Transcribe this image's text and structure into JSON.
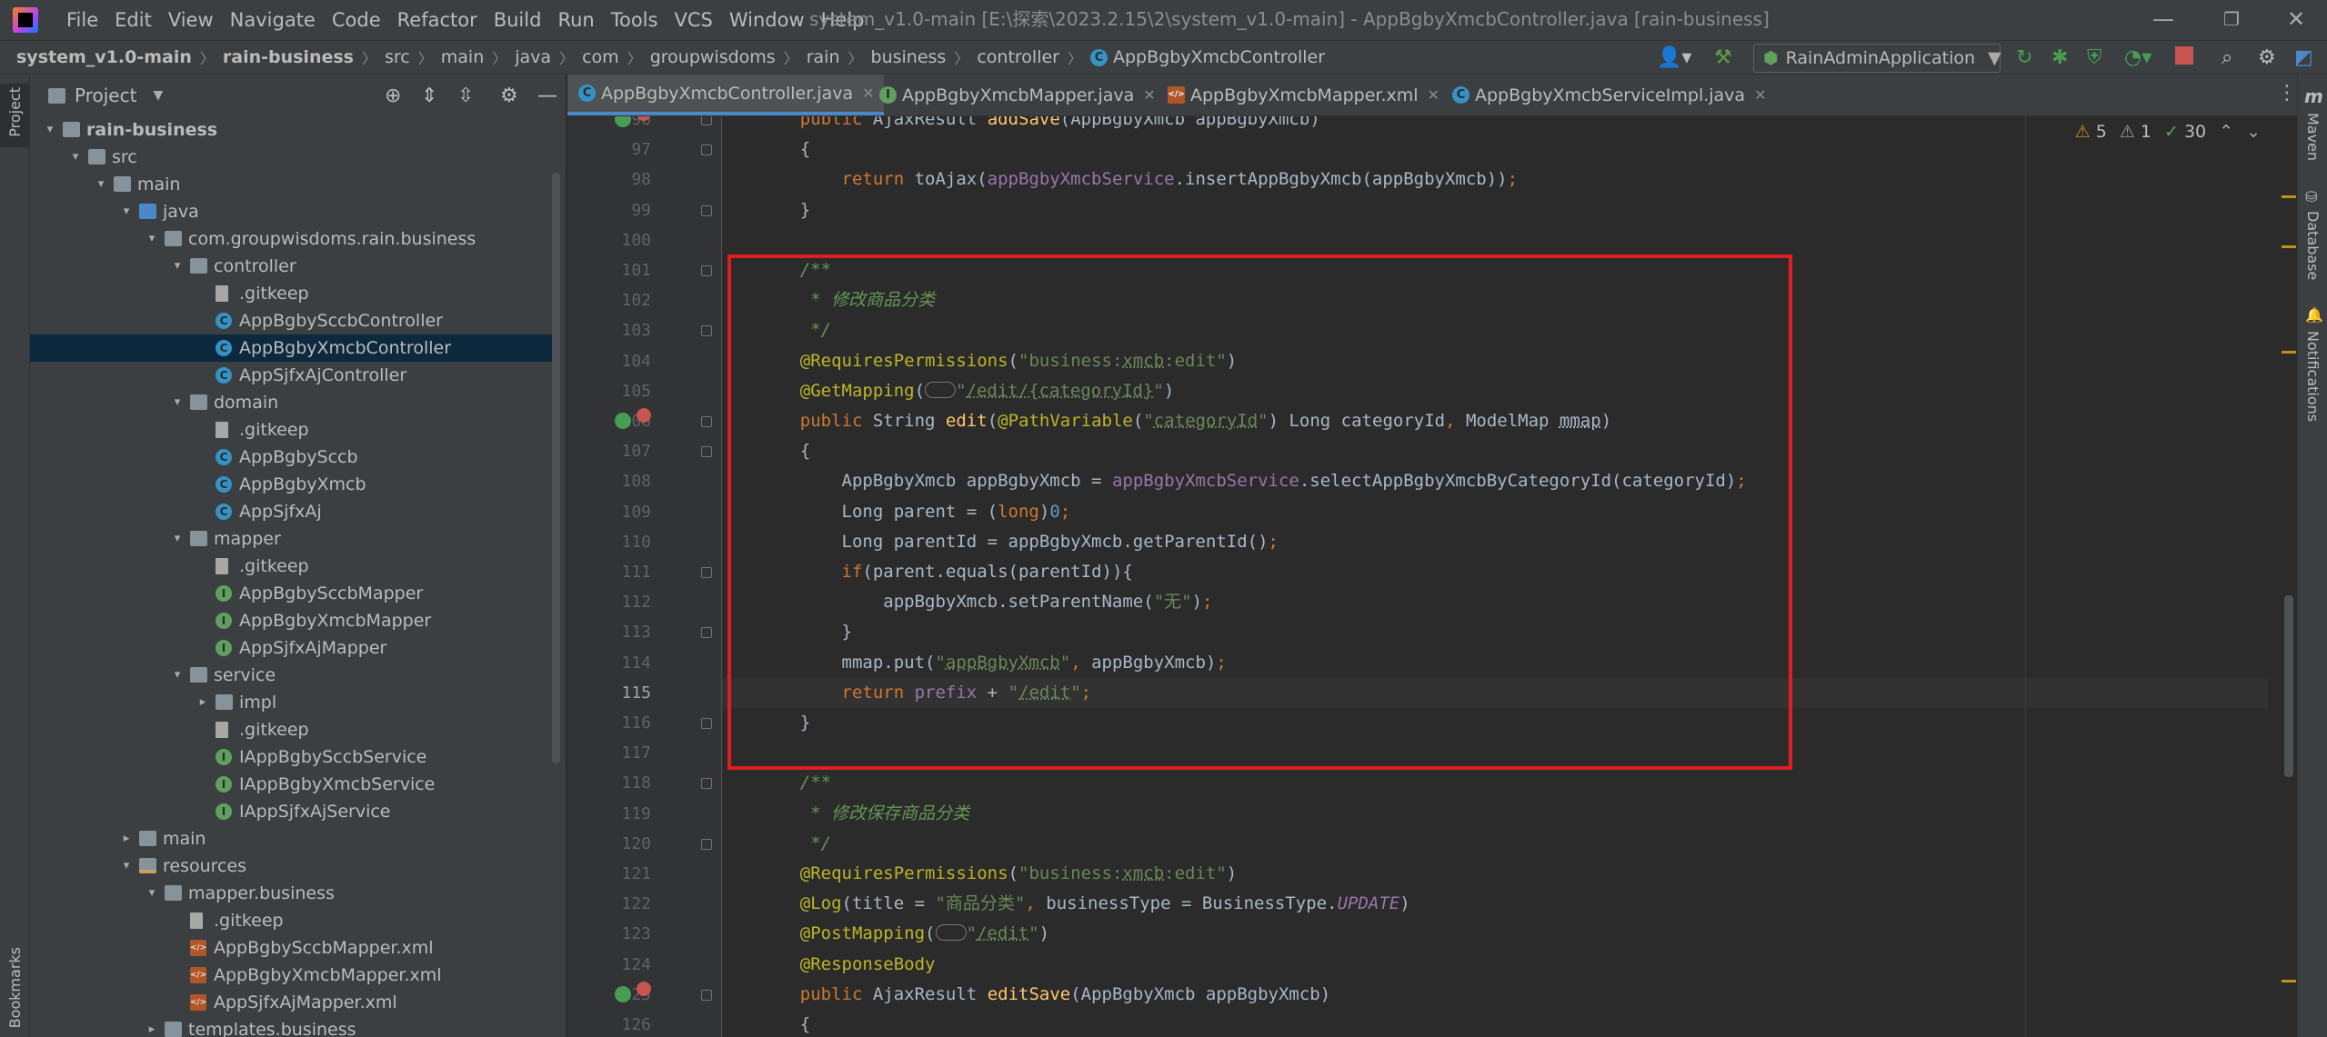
{
  "window": {
    "title": "system_v1.0-main [E:\\探索\\2023.2.15\\2\\system_v1.0-main] - AppBgbyXmcbController.java [rain-business]",
    "controls": [
      "—",
      "❐",
      "✕"
    ]
  },
  "menu": [
    "File",
    "Edit",
    "View",
    "Navigate",
    "Code",
    "Refactor",
    "Build",
    "Run",
    "Tools",
    "VCS",
    "Window",
    "Help"
  ],
  "breadcrumb": [
    "system_v1.0-main",
    "rain-business",
    "src",
    "main",
    "java",
    "com",
    "groupwisdoms",
    "rain",
    "business",
    "controller",
    "AppBgbyXmcbController"
  ],
  "run_config": {
    "label": "RainAdminApplication"
  },
  "sidebars": {
    "left_top": "Project",
    "left_bottom": "Bookmarks",
    "right": [
      "Maven",
      "Database",
      "Notifications"
    ]
  },
  "project_panel": {
    "title": "Project",
    "tree": [
      {
        "label": "rain-business",
        "depth": 0,
        "arrow": "▾",
        "icon": "folder",
        "bold": true
      },
      {
        "label": "src",
        "depth": 1,
        "arrow": "▾",
        "icon": "folder"
      },
      {
        "label": "main",
        "depth": 2,
        "arrow": "▾",
        "icon": "folder"
      },
      {
        "label": "java",
        "depth": 3,
        "arrow": "▾",
        "icon": "folder-blue"
      },
      {
        "label": "com.groupwisdoms.rain.business",
        "depth": 4,
        "arrow": "▾",
        "icon": "folder"
      },
      {
        "label": "controller",
        "depth": 5,
        "arrow": "▾",
        "icon": "folder"
      },
      {
        "label": ".gitkeep",
        "depth": 6,
        "arrow": "",
        "icon": "file"
      },
      {
        "label": "AppBgbySccbController",
        "depth": 6,
        "arrow": "",
        "icon": "class"
      },
      {
        "label": "AppBgbyXmcbController",
        "depth": 6,
        "arrow": "",
        "icon": "class",
        "selected": true
      },
      {
        "label": "AppSjfxAjController",
        "depth": 6,
        "arrow": "",
        "icon": "class"
      },
      {
        "label": "domain",
        "depth": 5,
        "arrow": "▾",
        "icon": "folder"
      },
      {
        "label": ".gitkeep",
        "depth": 6,
        "arrow": "",
        "icon": "file"
      },
      {
        "label": "AppBgbySccb",
        "depth": 6,
        "arrow": "",
        "icon": "class"
      },
      {
        "label": "AppBgbyXmcb",
        "depth": 6,
        "arrow": "",
        "icon": "class"
      },
      {
        "label": "AppSjfxAj",
        "depth": 6,
        "arrow": "",
        "icon": "class"
      },
      {
        "label": "mapper",
        "depth": 5,
        "arrow": "▾",
        "icon": "folder"
      },
      {
        "label": ".gitkeep",
        "depth": 6,
        "arrow": "",
        "icon": "file"
      },
      {
        "label": "AppBgbySccbMapper",
        "depth": 6,
        "arrow": "",
        "icon": "interface"
      },
      {
        "label": "AppBgbyXmcbMapper",
        "depth": 6,
        "arrow": "",
        "icon": "interface"
      },
      {
        "label": "AppSjfxAjMapper",
        "depth": 6,
        "arrow": "",
        "icon": "interface"
      },
      {
        "label": "service",
        "depth": 5,
        "arrow": "▾",
        "icon": "folder"
      },
      {
        "label": "impl",
        "depth": 6,
        "arrow": "▸",
        "icon": "folder"
      },
      {
        "label": ".gitkeep",
        "depth": 6,
        "arrow": "",
        "icon": "file"
      },
      {
        "label": "IAppBgbySccbService",
        "depth": 6,
        "arrow": "",
        "icon": "interface"
      },
      {
        "label": "IAppBgbyXmcbService",
        "depth": 6,
        "arrow": "",
        "icon": "interface"
      },
      {
        "label": "IAppSjfxAjService",
        "depth": 6,
        "arrow": "",
        "icon": "interface"
      },
      {
        "label": "main",
        "depth": 3,
        "arrow": "▸",
        "icon": "folder"
      },
      {
        "label": "resources",
        "depth": 3,
        "arrow": "▾",
        "icon": "folder-res"
      },
      {
        "label": "mapper.business",
        "depth": 4,
        "arrow": "▾",
        "icon": "folder"
      },
      {
        "label": ".gitkeep",
        "depth": 5,
        "arrow": "",
        "icon": "file"
      },
      {
        "label": "AppBgbySccbMapper.xml",
        "depth": 5,
        "arrow": "",
        "icon": "xml"
      },
      {
        "label": "AppBgbyXmcbMapper.xml",
        "depth": 5,
        "arrow": "",
        "icon": "xml"
      },
      {
        "label": "AppSjfxAjMapper.xml",
        "depth": 5,
        "arrow": "",
        "icon": "xml"
      },
      {
        "label": "templates.business",
        "depth": 4,
        "arrow": "▸",
        "icon": "folder"
      }
    ]
  },
  "tabs": [
    {
      "label": "AppBgbyXmcbController.java",
      "icon": "class",
      "active": true
    },
    {
      "label": "AppBgbyXmcbMapper.java",
      "icon": "interface"
    },
    {
      "label": "AppBgbyXmcbMapper.xml",
      "icon": "xml"
    },
    {
      "label": "AppBgbyXmcbServiceImpl.java",
      "icon": "class"
    }
  ],
  "inspections": {
    "warnings": "5",
    "weak_warnings": "1",
    "typos": "30"
  },
  "editor": {
    "current_line": "115",
    "lines": [
      {
        "n": "96",
        "tokens": [
          [
            "    ",
            ""
          ],
          [
            "public ",
            "kw"
          ],
          [
            "AjaxResult ",
            ""
          ],
          [
            "addSave",
            "fn"
          ],
          [
            "(AppBgbyXmcb appBgbyXmcb)",
            ""
          ]
        ]
      },
      {
        "n": "97",
        "tokens": [
          [
            "    {",
            ""
          ]
        ]
      },
      {
        "n": "98",
        "tokens": [
          [
            "        ",
            ""
          ],
          [
            "return ",
            "kw"
          ],
          [
            "toAjax(",
            ""
          ],
          [
            "appBgbyXmcbService",
            "field"
          ],
          [
            ".insertAppBgbyXmcb(appBgbyXmcb))",
            ""
          ],
          [
            ";",
            "kw"
          ]
        ]
      },
      {
        "n": "99",
        "tokens": [
          [
            "    }",
            ""
          ]
        ]
      },
      {
        "n": "100",
        "tokens": []
      },
      {
        "n": "101",
        "tokens": [
          [
            "    /**",
            "doc"
          ]
        ]
      },
      {
        "n": "102",
        "tokens": [
          [
            "     * 修改商品分类",
            "doc"
          ]
        ]
      },
      {
        "n": "103",
        "tokens": [
          [
            "     */",
            "doc"
          ]
        ]
      },
      {
        "n": "104",
        "tokens": [
          [
            "    ",
            ""
          ],
          [
            "@RequiresPermissions",
            "ann"
          ],
          [
            "(",
            ""
          ],
          [
            "\"business:",
            "str"
          ],
          [
            "xmcb",
            "str ul"
          ],
          [
            ":edit\"",
            "str"
          ],
          [
            ")",
            ""
          ]
        ]
      },
      {
        "n": "105",
        "tokens": [
          [
            "    ",
            ""
          ],
          [
            "@GetMapping",
            "ann"
          ],
          [
            "(",
            ""
          ],
          [
            "ICON",
            ""
          ],
          [
            "\"",
            "str"
          ],
          [
            "/edit/{categoryId}",
            "str ul"
          ],
          [
            "\"",
            "str"
          ],
          [
            ")",
            ""
          ]
        ]
      },
      {
        "n": "106",
        "tokens": [
          [
            "    ",
            ""
          ],
          [
            "public ",
            "kw"
          ],
          [
            "String ",
            ""
          ],
          [
            "edit",
            "fn"
          ],
          [
            "(",
            ""
          ],
          [
            "@PathVariable",
            "ann"
          ],
          [
            "(",
            ""
          ],
          [
            "\"",
            "str"
          ],
          [
            "categoryId",
            "str ul"
          ],
          [
            "\"",
            "str"
          ],
          [
            ") Long categoryId",
            ""
          ],
          [
            ", ",
            "kw"
          ],
          [
            "ModelMap ",
            ""
          ],
          [
            "mmap",
            "ul"
          ],
          [
            ")",
            ""
          ]
        ]
      },
      {
        "n": "107",
        "tokens": [
          [
            "    {",
            ""
          ]
        ]
      },
      {
        "n": "108",
        "tokens": [
          [
            "        AppBgbyXmcb appBgbyXmcb = ",
            ""
          ],
          [
            "appBgbyXmcbService",
            "field"
          ],
          [
            ".selectAppBgbyXmcbByCategoryId(categoryId)",
            ""
          ],
          [
            ";",
            "kw"
          ]
        ]
      },
      {
        "n": "109",
        "tokens": [
          [
            "        Long parent = (",
            ""
          ],
          [
            "long",
            "kw"
          ],
          [
            ")",
            ""
          ],
          [
            "0",
            "num"
          ],
          [
            ";",
            "kw"
          ]
        ]
      },
      {
        "n": "110",
        "tokens": [
          [
            "        Long parentId = appBgbyXmcb.getParentId()",
            ""
          ],
          [
            ";",
            "kw"
          ]
        ]
      },
      {
        "n": "111",
        "tokens": [
          [
            "        ",
            ""
          ],
          [
            "if",
            "kw"
          ],
          [
            "(parent.equals(parentId)){",
            ""
          ]
        ]
      },
      {
        "n": "112",
        "tokens": [
          [
            "            appBgbyXmcb.setParentName(",
            ""
          ],
          [
            "\"无\"",
            "str"
          ],
          [
            ")",
            ""
          ],
          [
            ";",
            "kw"
          ]
        ]
      },
      {
        "n": "113",
        "tokens": [
          [
            "        }",
            ""
          ]
        ]
      },
      {
        "n": "114",
        "tokens": [
          [
            "        mmap.put(",
            ""
          ],
          [
            "\"",
            "str"
          ],
          [
            "appBgbyXmcb",
            "str ul"
          ],
          [
            "\"",
            "str"
          ],
          [
            ", ",
            "kw"
          ],
          [
            "appBgbyXmcb)",
            ""
          ],
          [
            ";",
            "kw"
          ]
        ]
      },
      {
        "n": "115",
        "tokens": [
          [
            "        ",
            ""
          ],
          [
            "return ",
            "kw"
          ],
          [
            "prefix",
            "field"
          ],
          [
            " + ",
            ""
          ],
          [
            "\"",
            "str"
          ],
          [
            "/edit",
            "str ul"
          ],
          [
            "\"",
            "str"
          ],
          [
            ";",
            "kw"
          ]
        ]
      },
      {
        "n": "116",
        "tokens": [
          [
            "    }",
            ""
          ]
        ]
      },
      {
        "n": "117",
        "tokens": []
      },
      {
        "n": "118",
        "tokens": [
          [
            "    /**",
            "doc"
          ]
        ]
      },
      {
        "n": "119",
        "tokens": [
          [
            "     * 修改保存商品分类",
            "doc"
          ]
        ]
      },
      {
        "n": "120",
        "tokens": [
          [
            "     */",
            "doc"
          ]
        ]
      },
      {
        "n": "121",
        "tokens": [
          [
            "    ",
            ""
          ],
          [
            "@RequiresPermissions",
            "ann"
          ],
          [
            "(",
            ""
          ],
          [
            "\"business:",
            "str"
          ],
          [
            "xmcb",
            "str ul"
          ],
          [
            ":edit\"",
            "str"
          ],
          [
            ")",
            ""
          ]
        ]
      },
      {
        "n": "122",
        "tokens": [
          [
            "    ",
            ""
          ],
          [
            "@Log",
            "ann"
          ],
          [
            "(title = ",
            ""
          ],
          [
            "\"商品分类\"",
            "str"
          ],
          [
            ", ",
            "kw"
          ],
          [
            "businessType = BusinessType.",
            ""
          ],
          [
            "UPDATE",
            "cst"
          ],
          [
            ")",
            ""
          ]
        ]
      },
      {
        "n": "123",
        "tokens": [
          [
            "    ",
            ""
          ],
          [
            "@PostMapping",
            "ann"
          ],
          [
            "(",
            ""
          ],
          [
            "ICON",
            ""
          ],
          [
            "\"",
            "str"
          ],
          [
            "/edit",
            "str ul"
          ],
          [
            "\"",
            "str"
          ],
          [
            ")",
            ""
          ]
        ]
      },
      {
        "n": "124",
        "tokens": [
          [
            "    ",
            ""
          ],
          [
            "@ResponseBody",
            "ann"
          ]
        ]
      },
      {
        "n": "125",
        "tokens": [
          [
            "    ",
            ""
          ],
          [
            "public ",
            "kw"
          ],
          [
            "AjaxResult ",
            ""
          ],
          [
            "editSave",
            "fn"
          ],
          [
            "(AppBgbyXmcb appBgbyXmcb)",
            ""
          ]
        ]
      },
      {
        "n": "126",
        "tokens": [
          [
            "    {",
            ""
          ]
        ]
      }
    ]
  },
  "colors": {
    "highlight_box": "#e01c24",
    "accent": "#4a88c7"
  }
}
